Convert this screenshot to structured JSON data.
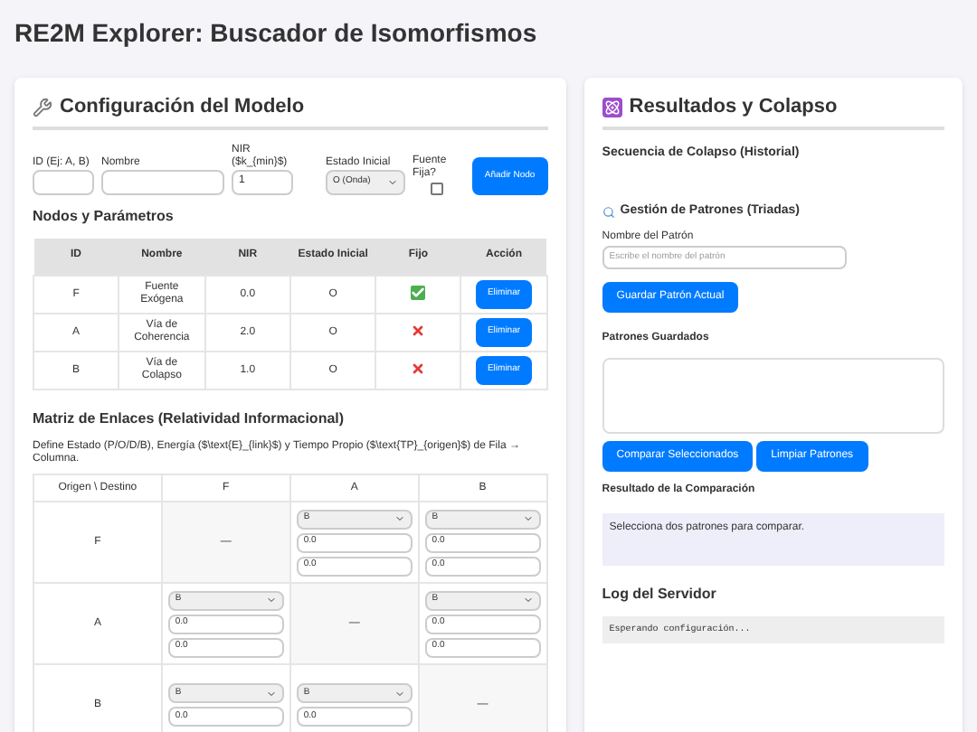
{
  "page_title": "RE2M Explorer: Buscador de Isomorfismos",
  "config": {
    "title": "Configuración del Modelo",
    "form": {
      "id_label": "ID (Ej: A, B)",
      "name_label": "Nombre",
      "nir_label": "NIR ($k_{min}$)",
      "nir_value": "1",
      "state_label": "Estado Inicial",
      "state_value": "O (Onda)",
      "fixed_label": "Fuente Fija?",
      "fixed_checked": false,
      "add_button": "Añadir Nodo"
    },
    "nodes_title": "Nodos y Parámetros",
    "nodes_columns": [
      "ID",
      "Nombre",
      "NIR",
      "Estado Inicial",
      "Fijo",
      "Acción"
    ],
    "nodes": [
      {
        "id": "F",
        "name": "Fuente Exógena",
        "nir": "0.0",
        "state": "O",
        "fixed": true,
        "action": "Eliminar"
      },
      {
        "id": "A",
        "name": "Vía de Coherencia",
        "nir": "2.0",
        "state": "O",
        "fixed": false,
        "action": "Eliminar"
      },
      {
        "id": "B",
        "name": "Vía de Colapso",
        "nir": "1.0",
        "state": "O",
        "fixed": false,
        "action": "Eliminar"
      }
    ],
    "matrix_title": "Matriz de Enlaces (Relatividad Informacional)",
    "matrix_desc": "Define Estado (P/O/D/B), Energía ($\\text{E}_{link}$) y Tiempo Propio ($\\text{TP}_{origen}$) de Fila → Columna.",
    "matrix_columns": [
      "Origen \\ Destino",
      "F",
      "A",
      "B"
    ],
    "matrix_rows": [
      {
        "label": "F",
        "cells": [
          {
            "kind": "self",
            "text": "—"
          },
          {
            "kind": "link",
            "state": "B",
            "energy": "0.0",
            "time": "0.0"
          },
          {
            "kind": "link",
            "state": "B",
            "energy": "0.0",
            "time": "0.0"
          }
        ]
      },
      {
        "label": "A",
        "cells": [
          {
            "kind": "link",
            "state": "B",
            "energy": "0.0",
            "time": "0.0"
          },
          {
            "kind": "self",
            "text": "—"
          },
          {
            "kind": "link",
            "state": "B",
            "energy": "0.0",
            "time": "0.0"
          }
        ]
      },
      {
        "label": "B",
        "cells": [
          {
            "kind": "link",
            "state": "B",
            "energy": "0.0"
          },
          {
            "kind": "link",
            "state": "B",
            "energy": "0.0"
          },
          {
            "kind": "self",
            "text": "—"
          }
        ]
      }
    ]
  },
  "results": {
    "title": "Resultados y Colapso",
    "history_title": "Secuencia de Colapso (Historial)",
    "patterns_title": "Gestión de Patrones (Triadas)",
    "pattern_name_label": "Nombre del Patrón",
    "pattern_name_placeholder": "Escribe el nombre del patrón",
    "save_button": "Guardar Patrón Actual",
    "saved_title": "Patrones Guardados",
    "compare_button": "Comparar Seleccionados",
    "clear_button": "Limpiar Patrones",
    "comparison_title": "Resultado de la Comparación",
    "comparison_text": "Selecciona dos patrones para comparar.",
    "log_title": "Log del Servidor",
    "log_text": "Esperando configuración..."
  }
}
